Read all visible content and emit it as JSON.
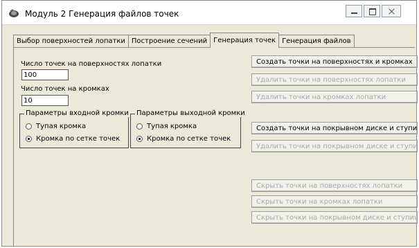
{
  "window": {
    "title": "Модуль 2  Генерация файлов точек"
  },
  "tabs": [
    {
      "label": "Выбор поверхностей лопатки"
    },
    {
      "label": "Построение сечений"
    },
    {
      "label": "Генерация точек"
    },
    {
      "label": "Генерация файлов"
    }
  ],
  "surface_points": {
    "label": "Число точек на поверхностях лопатки",
    "value": "100"
  },
  "edge_points": {
    "label": "Число точек на кромках",
    "value": "10"
  },
  "inlet_edge": {
    "title": "Параметры входной кромки",
    "options": [
      "Тупая кромка",
      "Кромка по сетке точек"
    ],
    "selected": "Кромка по сетке точек"
  },
  "outlet_edge": {
    "title": "Параметры выходной кромки",
    "options": [
      "Тупая кромка",
      "Кромка по сетке точек"
    ],
    "selected": "Кромка по сетке точек"
  },
  "buttons": [
    {
      "label": "Создать точки на поверхностях и кромках",
      "enabled": true
    },
    {
      "label": "Удалить точки на поверхностях лопатки",
      "enabled": false
    },
    {
      "label": "Удалить точки на кромках лопатки",
      "enabled": false
    },
    {
      "label": "Создать точки на покрывном диске и ступице",
      "enabled": true
    },
    {
      "label": "Удалить точки на покрывном диске и ступице",
      "enabled": false
    },
    {
      "label": "Скрыть точки на поверхностях лопатки",
      "enabled": false
    },
    {
      "label": "Скрыть точки на кромках лопатки",
      "enabled": false
    },
    {
      "label": "Скрыть точки на покрывном диске и ступице",
      "enabled": false
    }
  ]
}
